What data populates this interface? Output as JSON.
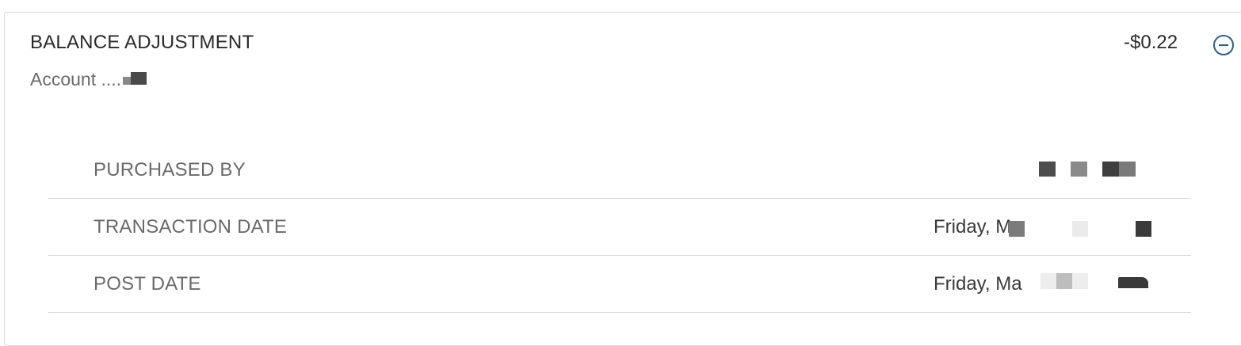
{
  "transaction": {
    "title": "BALANCE ADJUSTMENT",
    "account_prefix": "Account ....",
    "amount": "-$0.22",
    "collapse_icon": "minus-circle-icon",
    "accent_color": "#2f5f8a"
  },
  "details": [
    {
      "label": "PURCHASED BY",
      "value": ""
    },
    {
      "label": "TRANSACTION DATE",
      "value": "Friday, M"
    },
    {
      "label": "POST DATE",
      "value": "Friday, Ma"
    }
  ]
}
